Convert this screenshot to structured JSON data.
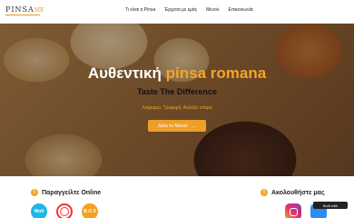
{
  "header": {
    "logo_text": "PINSA",
    "logo_suffix": "ME",
    "nav": [
      {
        "label": "Τι είναι η Pinsa"
      },
      {
        "label": "Έρχεται με εμάς"
      },
      {
        "label": "Μενού"
      },
      {
        "label": "Επικοινωνία"
      }
    ]
  },
  "hero": {
    "title_main": "Αυθεντική",
    "title_accent": "pinsa romana",
    "subtitle": "Taste The Difference",
    "tagline": "Λαχταρώ. Τρυφερή. Αλλάζει στόμα",
    "cta_label": "Δείτε το Μενού",
    "cta_arrow": "→"
  },
  "order_section": {
    "icon": "!",
    "title": "Παραγγείλτε Online",
    "apps": [
      {
        "name": "wolt",
        "label": "Wolt"
      },
      {
        "name": "efood",
        "label": ""
      },
      {
        "name": "box",
        "label": "B O X"
      }
    ]
  },
  "follow_section": {
    "icon": "!",
    "title": "Ακολουθήστε μας",
    "built_with": "Built with"
  },
  "colors": {
    "accent": "#f2a52c",
    "button": "#ef9f27"
  }
}
